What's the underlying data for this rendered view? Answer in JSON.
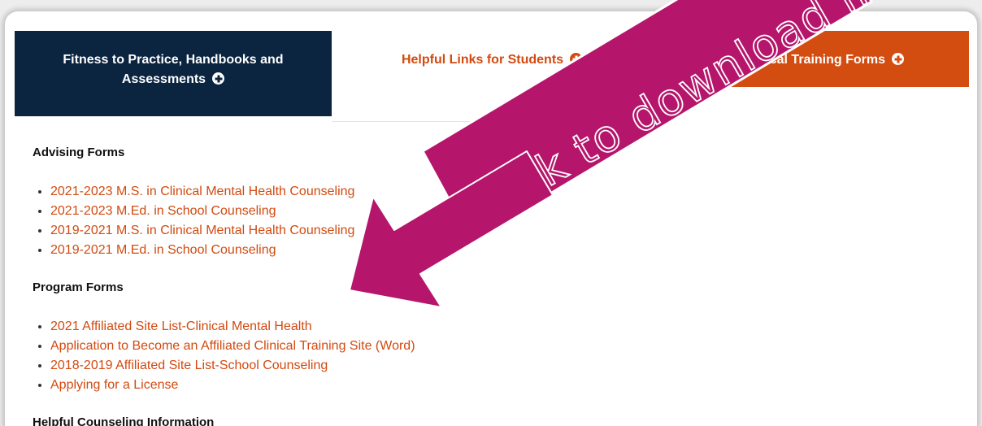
{
  "tabs": [
    {
      "label": "Fitness to Practice, Handbooks and Assessments",
      "icon": "plus-circle-icon"
    },
    {
      "label": "Helpful Links for Students",
      "icon": "plus-circle-icon"
    },
    {
      "label": "Clinical Training Forms",
      "icon": "plus-circle-icon"
    }
  ],
  "sections": [
    {
      "heading": "Advising Forms",
      "links": [
        "2021-2023 M.S. in Clinical Mental Health Counseling",
        "2021-2023 M.Ed. in School Counseling",
        "2019-2021 M.S. in Clinical Mental Health Counseling",
        "2019-2021 M.Ed. in School Counseling"
      ]
    },
    {
      "heading": "Program Forms",
      "links": [
        "2021 Affiliated Site List-Clinical Mental Health",
        "Application to Become an Affiliated Clinical Training Site (Word)",
        "2018-2019 Affiliated Site List-School Counseling",
        "Applying for a License"
      ]
    },
    {
      "heading": "Helpful Counseling Information"
    }
  ],
  "annotation": {
    "text": "Click to download list",
    "color": "#b5166b"
  },
  "colors": {
    "navy": "#0b2440",
    "orange": "#d44d10",
    "link": "#d24a10"
  }
}
